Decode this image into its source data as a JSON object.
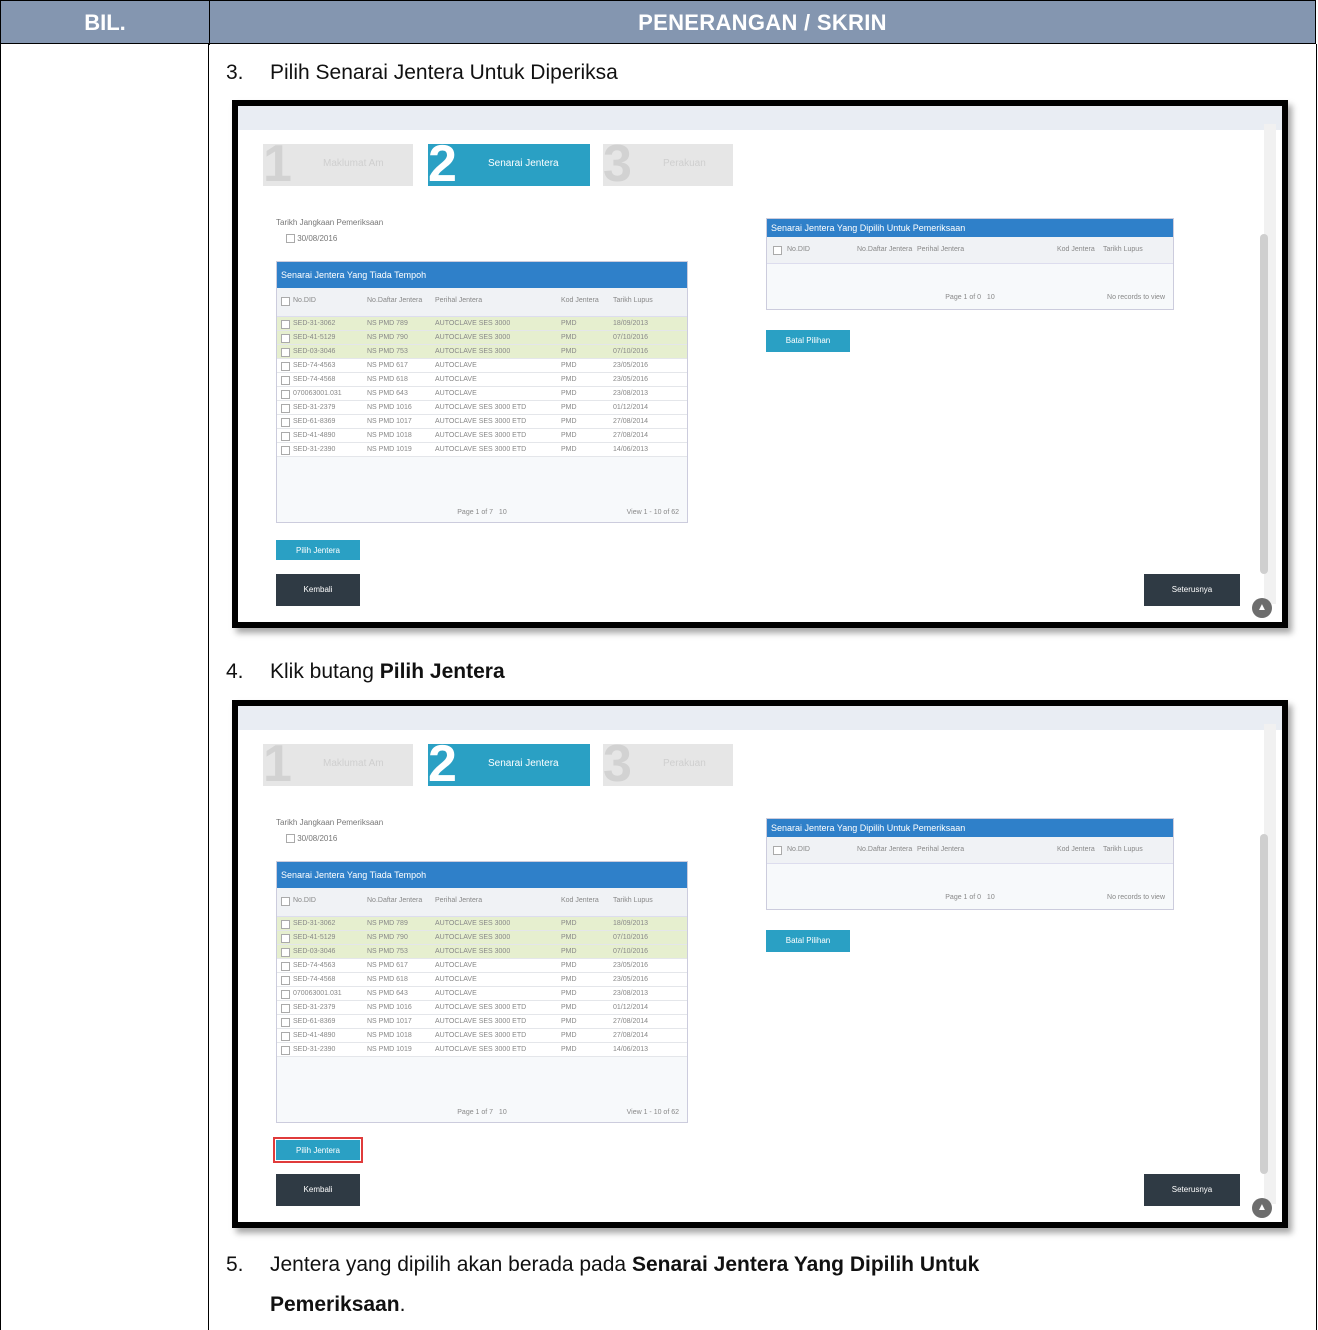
{
  "header": {
    "bil": "BIL.",
    "description": "PENERANGAN / SKRIN"
  },
  "steps": [
    {
      "num": "3.",
      "text": "Pilih Senarai Jentera Untuk Diperiksa"
    },
    {
      "num": "4.",
      "text_plain": "Klik butang ",
      "text_bold": "Pilih Jentera"
    },
    {
      "num": "5.",
      "text_plain": "Jentera yang dipilih akan berada pada ",
      "text_bold_1": "Senarai Jentera Yang Dipilih Untuk",
      "text_bold_2": "Pemeriksaan",
      "text_end": "."
    }
  ],
  "screen": {
    "wizard": [
      {
        "num": "1",
        "label": "Maklumat Am"
      },
      {
        "num": "2",
        "label": "Senarai Jentera"
      },
      {
        "num": "3",
        "label": "Perakuan"
      }
    ],
    "date_label": "Tarikh Jangkaan Pemeriksaan",
    "date_value": "30/08/2016",
    "left_grid": {
      "caption": "Senarai Jentera Yang Tiada Tempoh",
      "columns": [
        "No.DID",
        "No.Daftar Jentera",
        "Perihal Jentera",
        "Kod Jentera",
        "Tarikh Lupus"
      ],
      "rows": [
        [
          "SED-31-3062",
          "NS PMD 789",
          "AUTOCLAVE SES 3000",
          "PMD",
          "18/09/2013"
        ],
        [
          "SED-41-5129",
          "NS PMD 790",
          "AUTOCLAVE SES 3000",
          "PMD",
          "07/10/2016"
        ],
        [
          "SED-03-3046",
          "NS PMD 753",
          "AUTOCLAVE SES 3000",
          "PMD",
          "07/10/2016"
        ],
        [
          "SED-74-4563",
          "NS PMD 617",
          "AUTOCLAVE",
          "PMD",
          "23/05/2016"
        ],
        [
          "SED-74-4568",
          "NS PMD 618",
          "AUTOCLAVE",
          "PMD",
          "23/05/2016"
        ],
        [
          "0700​63001.031",
          "NS PMD 643",
          "AUTOCLAVE",
          "PMD",
          "23/08/2013"
        ],
        [
          "SED-31-2379",
          "NS PMD 1016",
          "AUTOCLAVE SES 3000 ETD",
          "PMD",
          "01/12/2014"
        ],
        [
          "SED-61-8369",
          "NS PMD 1017",
          "AUTOCLAVE SES 3000 ETD",
          "PMD",
          "27/08/2014"
        ],
        [
          "SED-41-4890",
          "NS PMD 1018",
          "AUTOCLAVE SES 3000 ETD",
          "PMD",
          "27/08/2014"
        ],
        [
          "SED-31-2390",
          "NS PMD 1019",
          "AUTOCLAVE SES 3000 ETD",
          "PMD",
          "14/06/2013"
        ]
      ],
      "pager": "Page 1 of 7",
      "per_page": "10",
      "view_info": "View 1 - 10 of 62"
    },
    "right_grid": {
      "caption": "Senarai Jentera Yang Dipilih Untuk Pemeriksaan",
      "columns": [
        "No.DID",
        "No.Daftar Jentera",
        "Perihal Jentera",
        "Kod Jentera",
        "Tarikh Lupus"
      ],
      "pager": "Page 1 of 0",
      "per_page": "10",
      "view_info": "No records to view"
    },
    "buttons": {
      "pilih": "Pilih Jentera",
      "batal": "Batal Pilihan",
      "kembali": "Kembali",
      "seterusnya": "Seterusnya"
    }
  }
}
